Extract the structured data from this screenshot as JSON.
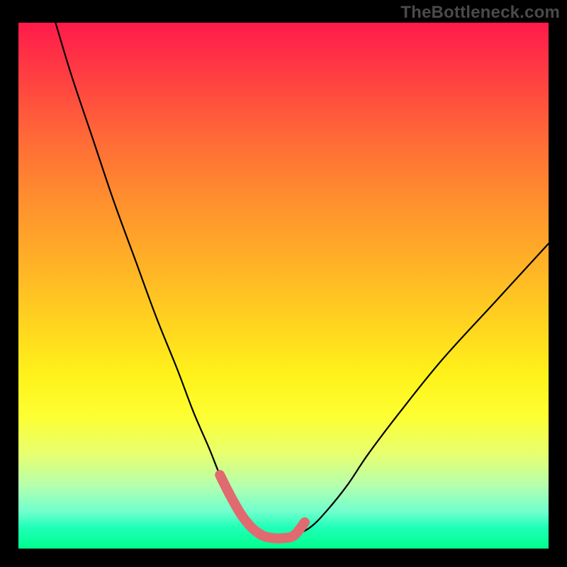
{
  "watermark": "TheBottleneck.com",
  "chart_data": {
    "type": "line",
    "title": "",
    "xlabel": "",
    "ylabel": "",
    "xlim": [
      0,
      100
    ],
    "ylim": [
      0,
      100
    ],
    "series": [
      {
        "name": "bottleneck-curve",
        "x": [
          7,
          10,
          14,
          18,
          22,
          26,
          30,
          33,
          36,
          38,
          40,
          42,
          44,
          46,
          48,
          50,
          52,
          55,
          58,
          62,
          66,
          72,
          80,
          90,
          100
        ],
        "y": [
          100,
          90,
          78,
          66,
          55,
          44,
          34,
          26,
          19,
          14,
          10,
          6.5,
          4,
          2.5,
          2,
          2,
          2.5,
          4,
          7,
          12,
          18,
          26,
          36,
          47,
          58
        ]
      },
      {
        "name": "highlight-band",
        "x": [
          38,
          40,
          42,
          44,
          46,
          48,
          50,
          52,
          54
        ],
        "y": [
          14,
          10,
          6.5,
          4,
          2.5,
          2,
          2,
          2.5,
          5
        ]
      }
    ],
    "highlight_color": "#e06a6f",
    "curve_color": "#000000",
    "gradient_stops": [
      {
        "pos": 0,
        "color": "#ff1a4b"
      },
      {
        "pos": 50,
        "color": "#ffd61f"
      },
      {
        "pos": 80,
        "color": "#fdff33"
      },
      {
        "pos": 100,
        "color": "#00ff8d"
      }
    ]
  }
}
